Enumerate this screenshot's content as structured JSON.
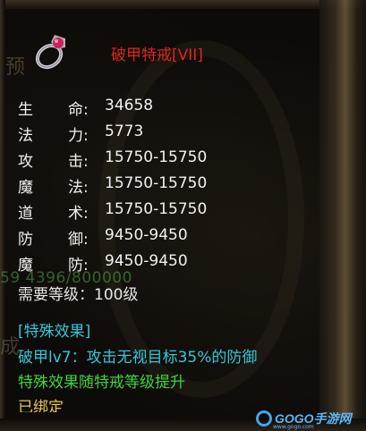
{
  "item": {
    "icon": "ring-icon",
    "title": "破甲特戒[VII]",
    "title_color": "#e0251b"
  },
  "stats": [
    {
      "k1": "生",
      "k2": "命:",
      "value": "34658"
    },
    {
      "k1": "法",
      "k2": "力:",
      "value": "5773"
    },
    {
      "k1": "攻",
      "k2": "击:",
      "value": "15750-15750"
    },
    {
      "k1": "魔",
      "k2": "法:",
      "value": "15750-15750"
    },
    {
      "k1": "道",
      "k2": "术:",
      "value": "15750-15750"
    },
    {
      "k1": "防",
      "k2": "御:",
      "value": "9450-9450"
    },
    {
      "k1": "魔",
      "k2": "防:",
      "value": "9450-9450"
    }
  ],
  "requirement": "需要等级：100级",
  "special": {
    "title": "[特殊效果]",
    "effect": "破甲lv7：攻击无视目标35%的防御",
    "note": "特殊效果随特戒等级提升"
  },
  "bound_text": "已绑定",
  "background_text": {
    "left_top": "预",
    "left_mid": "成",
    "green_line": "59 4396/800000"
  },
  "watermark": {
    "brand": "GOGO手游网",
    "url": "www.gogo.com"
  },
  "colors": {
    "stat_text": "#f2f2f2",
    "special": "#35c7d8",
    "effect_note": "#3fd43f",
    "bound": "#e6c84a"
  }
}
